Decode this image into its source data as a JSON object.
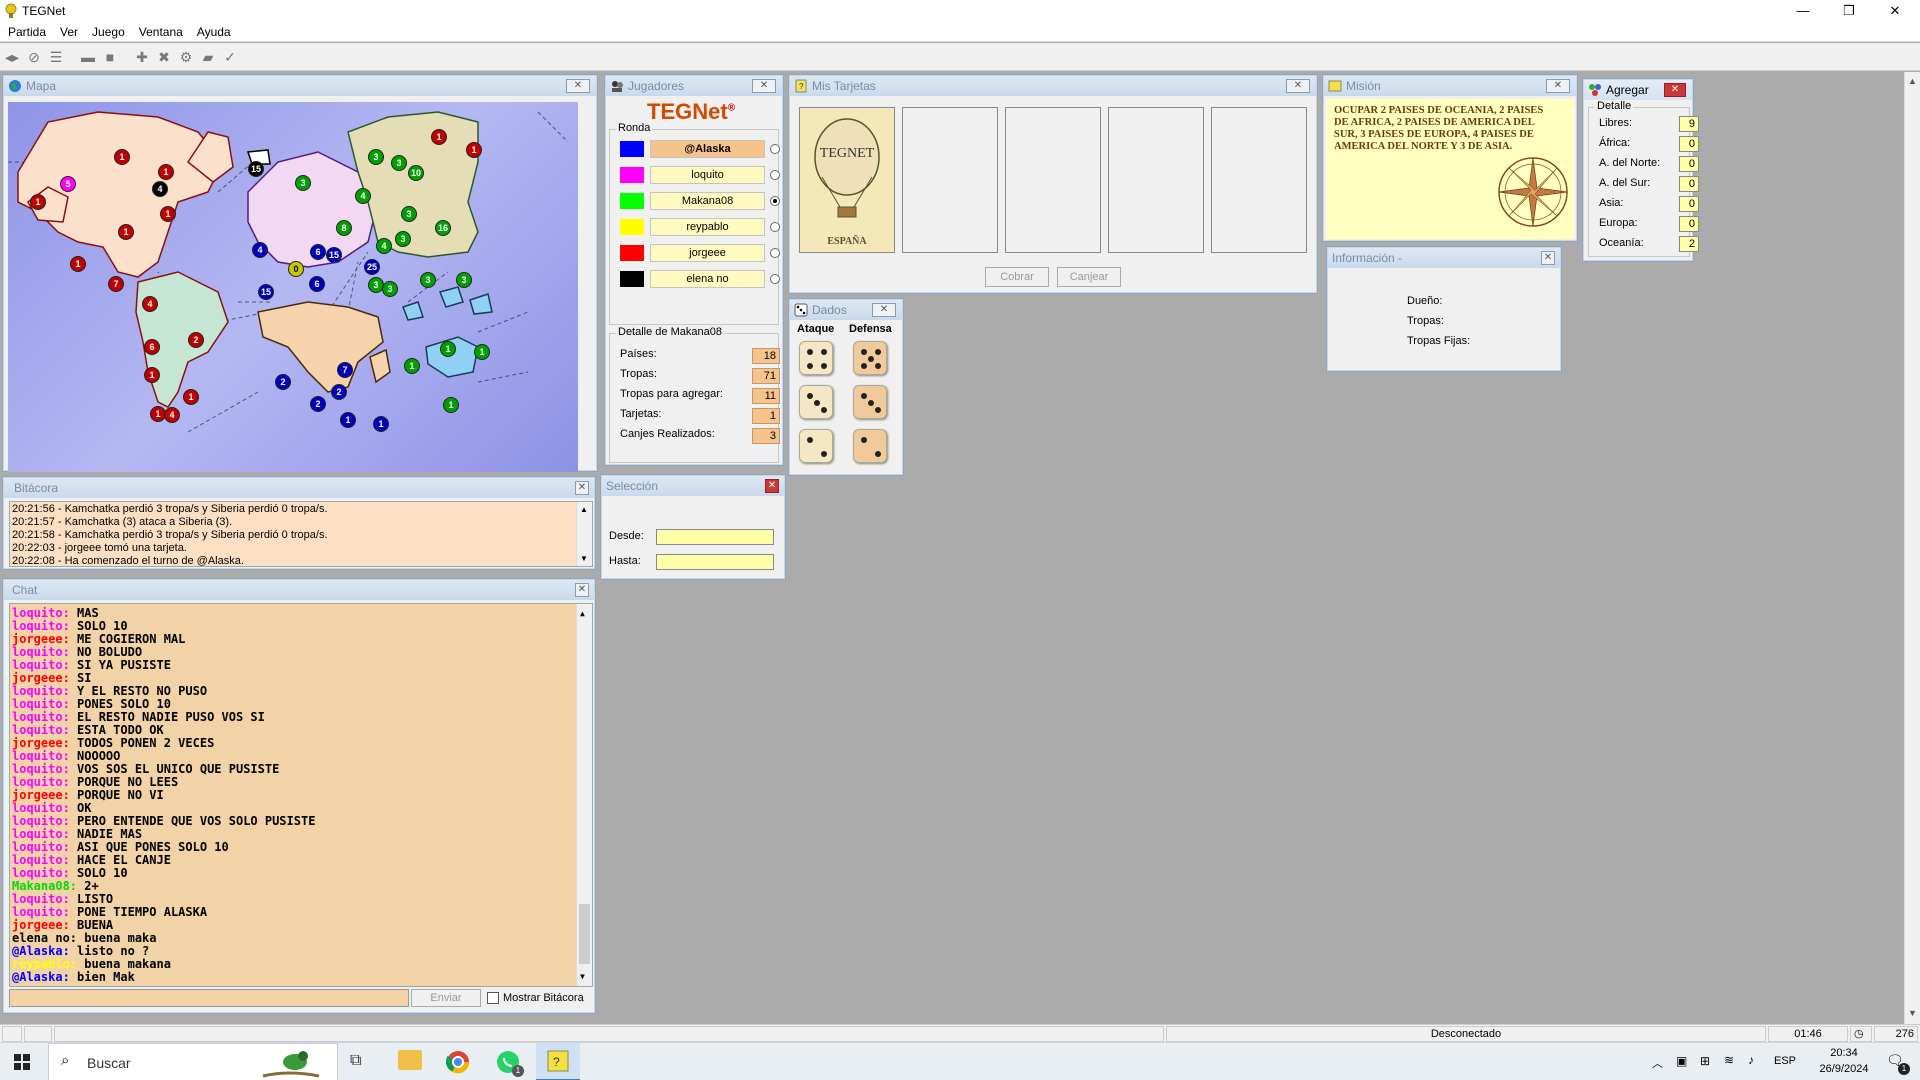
{
  "app": {
    "title": "TEGNet",
    "window_controls": {
      "minimize": "—",
      "maximize": "❐",
      "close": "✕"
    }
  },
  "menu": [
    "Partida",
    "Ver",
    "Juego",
    "Ventana",
    "Ayuda"
  ],
  "windows": {
    "mapa": {
      "title": "Mapa"
    },
    "jugadores": {
      "title": "Jugadores",
      "brand": "TEGNet",
      "brand_mark": "®",
      "ronda_label": "Ronda",
      "players": [
        {
          "name": "@Alaska",
          "color": "#0000ff",
          "selected": false,
          "active": true
        },
        {
          "name": "loquito",
          "color": "#ff00ff",
          "selected": false,
          "active": false
        },
        {
          "name": "Makana08",
          "color": "#00ff00",
          "selected": true,
          "active": false
        },
        {
          "name": "reypablo",
          "color": "#ffff00",
          "selected": false,
          "active": false
        },
        {
          "name": "jorgeee",
          "color": "#ff0000",
          "selected": false,
          "active": false
        },
        {
          "name": "elena no",
          "color": "#000000",
          "selected": false,
          "active": false
        }
      ],
      "detalle_label": "Detalle de Makana08",
      "detalle": [
        {
          "label": "Países:",
          "value": "18"
        },
        {
          "label": "Tropas:",
          "value": "71"
        },
        {
          "label": "Tropas para agregar:",
          "value": "11"
        },
        {
          "label": "Tarjetas:",
          "value": "1"
        },
        {
          "label": "Canjes Realizados:",
          "value": "3"
        }
      ]
    },
    "tarjetas": {
      "title": "Mis Tarjetas",
      "card_brand": "TEGNET",
      "card_country": "ESPAÑA",
      "cobrar": "Cobrar",
      "canjear": "Canjear"
    },
    "mision": {
      "title": "Misión",
      "text": "OCUPAR 2 PAISES DE OCEANIA, 2 PAISES DE AFRICA, 2 PAISES DE AMERICA DEL SUR, 3 PAISES DE EUROPA, 4 PAISES DE AMERICA DEL NORTE Y 3 DE ASIA."
    },
    "agregar": {
      "title": "Agregar",
      "detalle_label": "Detalle",
      "rows": [
        {
          "label": "Libres:",
          "value": "9"
        },
        {
          "label": "África:",
          "value": "0"
        },
        {
          "label": "A. del Norte:",
          "value": "0"
        },
        {
          "label": "A. del Sur:",
          "value": "0"
        },
        {
          "label": "Asia:",
          "value": "0"
        },
        {
          "label": "Europa:",
          "value": "0"
        },
        {
          "label": "Oceanía:",
          "value": "2"
        }
      ]
    },
    "informacion": {
      "title": "Información -",
      "owner_label": "Dueño:",
      "troops_label": "Tropas:",
      "fixed_label": "Tropas Fijas:"
    },
    "dados": {
      "title": "Dados",
      "ataque": "Ataque",
      "defensa": "Defensa",
      "attack_values": [
        4,
        3,
        2
      ],
      "defense_values": [
        5,
        3,
        2
      ]
    },
    "bitacora": {
      "title": "Bitácora",
      "lines": [
        "20:21:56 - Kamchatka perdió 3 tropa/s y Siberia perdió 0 tropa/s.",
        "20:21:57 - Kamchatka (3) ataca a Siberia (3).",
        "20:21:58 - Kamchatka perdió 3 tropa/s y Siberia perdió 0 tropa/s.",
        "20:22:03 - jorgeee tomó una tarjeta.",
        "20:22:08 - Ha comenzado el turno de @Alaska."
      ]
    },
    "seleccion": {
      "title": "Selección",
      "desde": "Desde:",
      "hasta": "Hasta:"
    },
    "chat": {
      "title": "Chat",
      "send": "Enviar",
      "show_log": "Mostrar Bitácora",
      "messages": [
        {
          "user": "loquito:",
          "color": "#ff00ff",
          "text": "MAS"
        },
        {
          "user": "loquito:",
          "color": "#ff00ff",
          "text": "SOLO 10"
        },
        {
          "user": "jorgeee:",
          "color": "#ff0000",
          "text": "ME COGIERON MAL"
        },
        {
          "user": "loquito:",
          "color": "#ff00ff",
          "text": "NO BOLUDO"
        },
        {
          "user": "loquito:",
          "color": "#ff00ff",
          "text": "SI YA PUSISTE"
        },
        {
          "user": "jorgeee:",
          "color": "#ff0000",
          "text": "SI"
        },
        {
          "user": "loquito:",
          "color": "#ff00ff",
          "text": "Y EL RESTO NO PUSO"
        },
        {
          "user": "loquito:",
          "color": "#ff00ff",
          "text": "PONES SOLO 10"
        },
        {
          "user": "loquito:",
          "color": "#ff00ff",
          "text": "EL RESTO NADIE PUSO VOS SI"
        },
        {
          "user": "loquito:",
          "color": "#ff00ff",
          "text": "ESTA TODO OK"
        },
        {
          "user": "jorgeee:",
          "color": "#ff0000",
          "text": "TODOS PONEN 2 VECES"
        },
        {
          "user": "loquito:",
          "color": "#ff00ff",
          "text": "NOOOOO"
        },
        {
          "user": "loquito:",
          "color": "#ff00ff",
          "text": "VOS SOS EL UNICO QUE PUSISTE"
        },
        {
          "user": "loquito:",
          "color": "#ff00ff",
          "text": "PORQUE NO LEES"
        },
        {
          "user": "jorgeee:",
          "color": "#ff0000",
          "text": "PORQUE NO VI"
        },
        {
          "user": "loquito:",
          "color": "#ff00ff",
          "text": "OK"
        },
        {
          "user": "loquito:",
          "color": "#ff00ff",
          "text": "PERO ENTENDE QUE VOS SOLO PUSISTE"
        },
        {
          "user": "loquito:",
          "color": "#ff00ff",
          "text": "NADIE MAS"
        },
        {
          "user": "loquito:",
          "color": "#ff00ff",
          "text": "ASI QUE PONES SOLO 10"
        },
        {
          "user": "loquito:",
          "color": "#ff00ff",
          "text": "HACE EL CANJE"
        },
        {
          "user": "loquito:",
          "color": "#ff00ff",
          "text": "SOLO 10"
        },
        {
          "user": "Makana08:",
          "color": "#00dd00",
          "text": "2+"
        },
        {
          "user": "loquito:",
          "color": "#ff00ff",
          "text": "LISTO"
        },
        {
          "user": "loquito:",
          "color": "#ff00ff",
          "text": "PONE TIEMPO ALASKA"
        },
        {
          "user": "jorgeee:",
          "color": "#ff0000",
          "text": "BUENA"
        },
        {
          "user": "elena no:",
          "color": "#000000",
          "text": "buena maka"
        },
        {
          "user": "@Alaska:",
          "color": "#0000ff",
          "text": "listo no ?"
        },
        {
          "user": "reypablo:",
          "color": "#ffff00",
          "text": "buena makana"
        },
        {
          "user": "@Alaska:",
          "color": "#0000ff",
          "text": "bien Mak"
        }
      ]
    }
  },
  "map": {
    "armies": [
      {
        "n": "1",
        "c": "#c00000"
      },
      {
        "n": "1",
        "c": "#c00000"
      },
      {
        "n": "5",
        "c": "#ff00ff"
      },
      {
        "n": "4",
        "c": "#000000"
      },
      {
        "n": "1",
        "c": "#c00000"
      },
      {
        "n": "1",
        "c": "#c00000"
      },
      {
        "n": "1",
        "c": "#c00000"
      },
      {
        "n": "1",
        "c": "#c00000"
      },
      {
        "n": "7",
        "c": "#c00000"
      },
      {
        "n": "4",
        "c": "#c00000"
      },
      {
        "n": "15",
        "c": "#000000"
      },
      {
        "n": "4",
        "c": "#0000c0"
      },
      {
        "n": "6",
        "c": "#0000c0"
      },
      {
        "n": "15",
        "c": "#0000c0"
      },
      {
        "n": "6",
        "c": "#0000c0"
      },
      {
        "n": "15",
        "c": "#0000c0"
      },
      {
        "n": "0",
        "c": "#c8c800"
      },
      {
        "n": "25",
        "c": "#0000c0"
      },
      {
        "n": "3",
        "c": "#00a000"
      },
      {
        "n": "3",
        "c": "#00a000"
      },
      {
        "n": "3",
        "c": "#00a000"
      },
      {
        "n": "4",
        "c": "#00a000"
      },
      {
        "n": "10",
        "c": "#00a000"
      },
      {
        "n": "1",
        "c": "#c00000"
      },
      {
        "n": "1",
        "c": "#c00000"
      },
      {
        "n": "8",
        "c": "#00a000"
      },
      {
        "n": "3",
        "c": "#00a000"
      },
      {
        "n": "4",
        "c": "#00a000"
      },
      {
        "n": "3",
        "c": "#00a000"
      },
      {
        "n": "16",
        "c": "#00a000"
      },
      {
        "n": "3",
        "c": "#00a000"
      },
      {
        "n": "3",
        "c": "#00a000"
      },
      {
        "n": "3",
        "c": "#00a000"
      },
      {
        "n": "3",
        "c": "#00a000"
      },
      {
        "n": "6",
        "c": "#c00000"
      },
      {
        "n": "2",
        "c": "#c00000"
      },
      {
        "n": "1",
        "c": "#c00000"
      },
      {
        "n": "1",
        "c": "#c00000"
      },
      {
        "n": "1",
        "c": "#c00000"
      },
      {
        "n": "4",
        "c": "#c00000"
      },
      {
        "n": "2",
        "c": "#0000c0"
      },
      {
        "n": "7",
        "c": "#0000c0"
      },
      {
        "n": "2",
        "c": "#0000c0"
      },
      {
        "n": "2",
        "c": "#0000c0"
      },
      {
        "n": "1",
        "c": "#0000c0"
      },
      {
        "n": "1",
        "c": "#0000c0"
      },
      {
        "n": "1",
        "c": "#00a000"
      },
      {
        "n": "1",
        "c": "#00a000"
      },
      {
        "n": "1",
        "c": "#00a000"
      },
      {
        "n": "1",
        "c": "#00a000"
      }
    ]
  },
  "status": {
    "left": "",
    "connection": "Desconectado",
    "time": "01:46",
    "count": "276"
  },
  "taskbar": {
    "search": "Buscar",
    "lang": "ESP",
    "clock_time": "20:34",
    "clock_date": "26/9/2024",
    "notif": "1",
    "whatsapp_badge": "1"
  }
}
